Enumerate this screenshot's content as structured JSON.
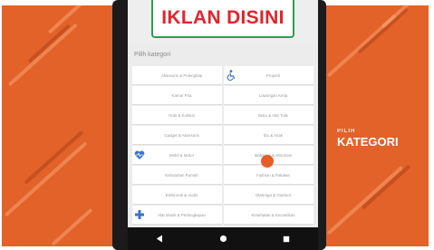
{
  "overlay": {
    "small_label": "PILIH",
    "big_label": "KATEGORI"
  },
  "banner": {
    "text": "IKLAN DISINI",
    "text_color": "#e2232c",
    "border_color": "#2e9c4f"
  },
  "category_header": "Pilih kategori",
  "categories": {
    "left": [
      {
        "label": "Aksesoris & Pelengkap"
      },
      {
        "label": "Kamar Pria"
      },
      {
        "label": "Hobi & Koleksi"
      },
      {
        "label": "Gadget & Aksesoris"
      },
      {
        "label": "Mobil & Motor"
      },
      {
        "label": "Kebutuhan Rumah"
      },
      {
        "label": "Elektronik & Audio"
      },
      {
        "label": "Alat Musik & Perlengkapan"
      }
    ],
    "right": [
      {
        "label": "Properti"
      },
      {
        "label": "Lowongan Kerja"
      },
      {
        "label": "Buku & Alat Tulis"
      },
      {
        "label": "Ibu & Anak"
      },
      {
        "label": "Makanan & Minuman"
      },
      {
        "label": "Fashion & Pakaian"
      },
      {
        "label": "Olahraga & Outdoor"
      },
      {
        "label": "Kesehatan & Kecantikan"
      }
    ]
  },
  "navbar": {
    "back": "back-triangle-icon",
    "home": "home-circle-icon",
    "recent": "recent-square-icon"
  },
  "colors": {
    "backdrop": "#e2622a",
    "accent_dot": "#e55d28",
    "icon_blue": "#3a74c9"
  }
}
